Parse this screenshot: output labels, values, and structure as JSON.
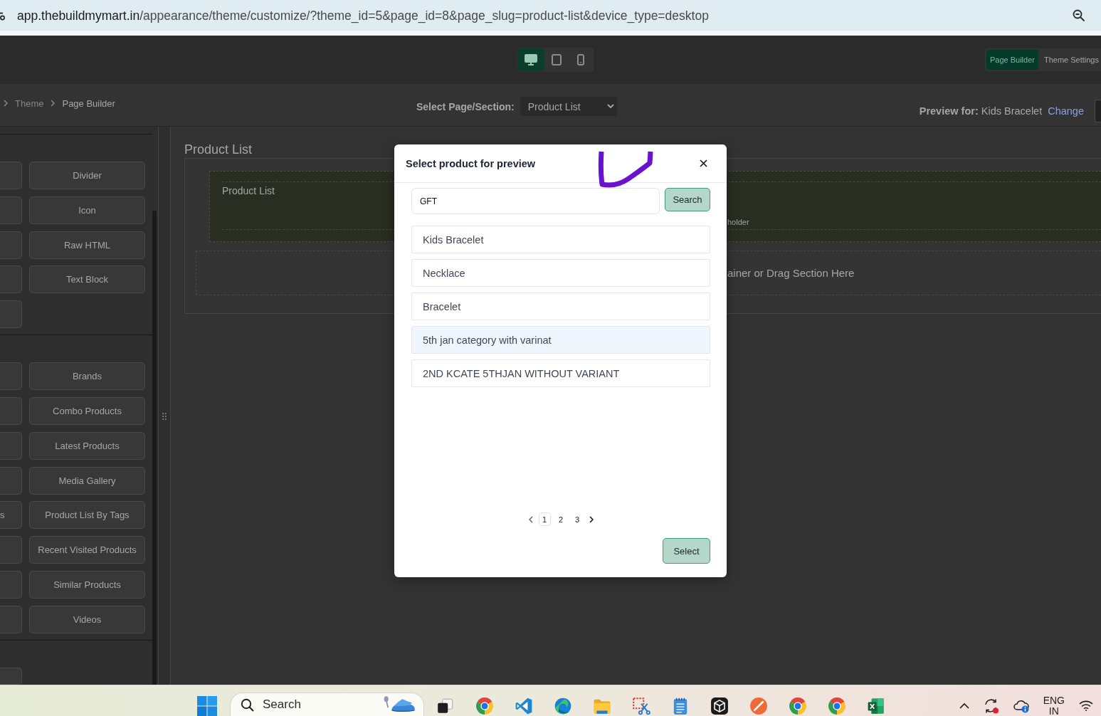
{
  "browser": {
    "url_host": "app.thebuildmymart.in",
    "url_path": "/appearance/theme/customize/?theme_id=5&page_id=8&page_slug=product-list&device_type=desktop"
  },
  "toolbar": {
    "devices": [
      {
        "kind": "desktop",
        "selected": true
      },
      {
        "kind": "tablet",
        "selected": false
      },
      {
        "kind": "mobile",
        "selected": false
      }
    ],
    "modes": [
      {
        "label": "Page Builder",
        "selected": true
      },
      {
        "label": "Theme Settings",
        "selected": false
      }
    ]
  },
  "subbar": {
    "breadcrumb": [
      {
        "label": "Theme",
        "current": false
      },
      {
        "label": "Page Builder",
        "current": true
      }
    ],
    "page_select": {
      "label": "Select Page/Section:",
      "value": "Product List"
    },
    "preview": {
      "text": "**Preview for:** Kids Bracelet",
      "link": "Change"
    }
  },
  "sidebar": {
    "groups": [
      {
        "cut_items": [
          {
            "kind": "blank"
          },
          {
            "kind": "blank"
          },
          {
            "kind": "blank"
          },
          {
            "kind": "blank"
          },
          {
            "kind": "blank"
          }
        ],
        "items": [
          "Divider",
          "Icon",
          "Raw HTML",
          "Text Block"
        ]
      },
      {
        "cut_items": [
          {
            "kind": "blank"
          },
          {
            "kind": "blank"
          },
          {
            "kind": "blank"
          },
          {
            "kind": "blank"
          },
          {
            "kind": "text",
            "text": "s"
          },
          {
            "kind": "blank"
          },
          {
            "kind": "blank"
          },
          {
            "kind": "blank"
          }
        ],
        "items": [
          "Brands",
          "Combo Products",
          "Latest Products",
          "Media Gallery",
          "Product List By Tags",
          "Recent Visited Products",
          "Similar Products",
          "Videos"
        ]
      },
      {
        "cut_items": [
          {
            "kind": "blank"
          }
        ]
      }
    ]
  },
  "canvas": {
    "heading": "Product List",
    "section": {
      "label": "Product List",
      "hint": "holder"
    },
    "drop_zone": "ainer or Drag Section Here"
  },
  "modal": {
    "title": "Select product for preview",
    "search": {
      "value": "GFT",
      "button": "Search"
    },
    "products": [
      {
        "name": "Kids Bracelet",
        "selected": false
      },
      {
        "name": "Necklace",
        "selected": false
      },
      {
        "name": "Bracelet",
        "selected": false
      },
      {
        "name": "5th jan category with varinat",
        "selected": true
      },
      {
        "name": "2ND KCATE 5THJAN WITHOUT VARIANT",
        "selected": false
      }
    ],
    "pagination": {
      "pages": [
        {
          "label": "1",
          "selected": true
        },
        {
          "label": "2",
          "selected": false
        },
        {
          "label": "3",
          "selected": false
        }
      ]
    },
    "action": "Select"
  },
  "taskbar": {
    "search": {
      "placeholder": "Search"
    },
    "apps": [
      {
        "kind": "task-view"
      },
      {
        "kind": "browser"
      },
      {
        "kind": "code-editor"
      },
      {
        "kind": "swirl"
      },
      {
        "kind": "folder"
      },
      {
        "kind": "snip"
      },
      {
        "kind": "notepad"
      },
      {
        "kind": "cube"
      },
      {
        "kind": "pen"
      },
      {
        "kind": "browser"
      },
      {
        "kind": "browser"
      },
      {
        "kind": "spreadsheet"
      }
    ],
    "language": {
      "code": "ENG",
      "region": "IN"
    }
  }
}
